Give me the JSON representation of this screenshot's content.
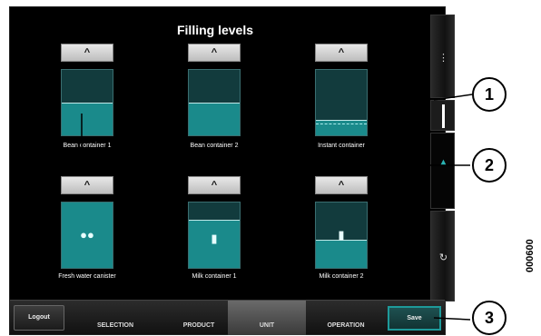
{
  "title": "Filling levels",
  "up_arrow": "^",
  "containers": [
    {
      "label": "Bean container 1",
      "level_fraction": 0.48,
      "marker_fraction": 0.52,
      "glyph": ""
    },
    {
      "label": "Bean container 2",
      "level_fraction": 0.48,
      "marker_fraction": 0.48,
      "glyph": ""
    },
    {
      "label": "Instant container",
      "level_fraction": 0.22,
      "marker_fraction": 0.22,
      "glyph": ""
    },
    {
      "label": "Fresh water canister",
      "level_fraction": 1.0,
      "marker_fraction": 1.0,
      "glyph": "drops-icon"
    },
    {
      "label": "Milk container 1",
      "level_fraction": 0.72,
      "marker_fraction": 0.72,
      "glyph": "bottle-icon"
    },
    {
      "label": "Milk container 2",
      "level_fraction": 0.42,
      "marker_fraction": 0.42,
      "glyph": "bottle-icon"
    }
  ],
  "rail_icons": [
    "drops-icon",
    "level-icon",
    "cleaning-icon"
  ],
  "bottombar": {
    "logout": "Logout",
    "tabs": [
      "SELECTION",
      "PRODUCT",
      "UNIT",
      "OPERATION"
    ],
    "active_tab": "UNIT",
    "save": "Save"
  },
  "callouts": [
    "1",
    "2",
    "3"
  ],
  "figure_code": "000600",
  "colors": {
    "fill": "#1a8a8b",
    "tank_bg": "#123b3d",
    "save_border": "#1e9a9a"
  }
}
